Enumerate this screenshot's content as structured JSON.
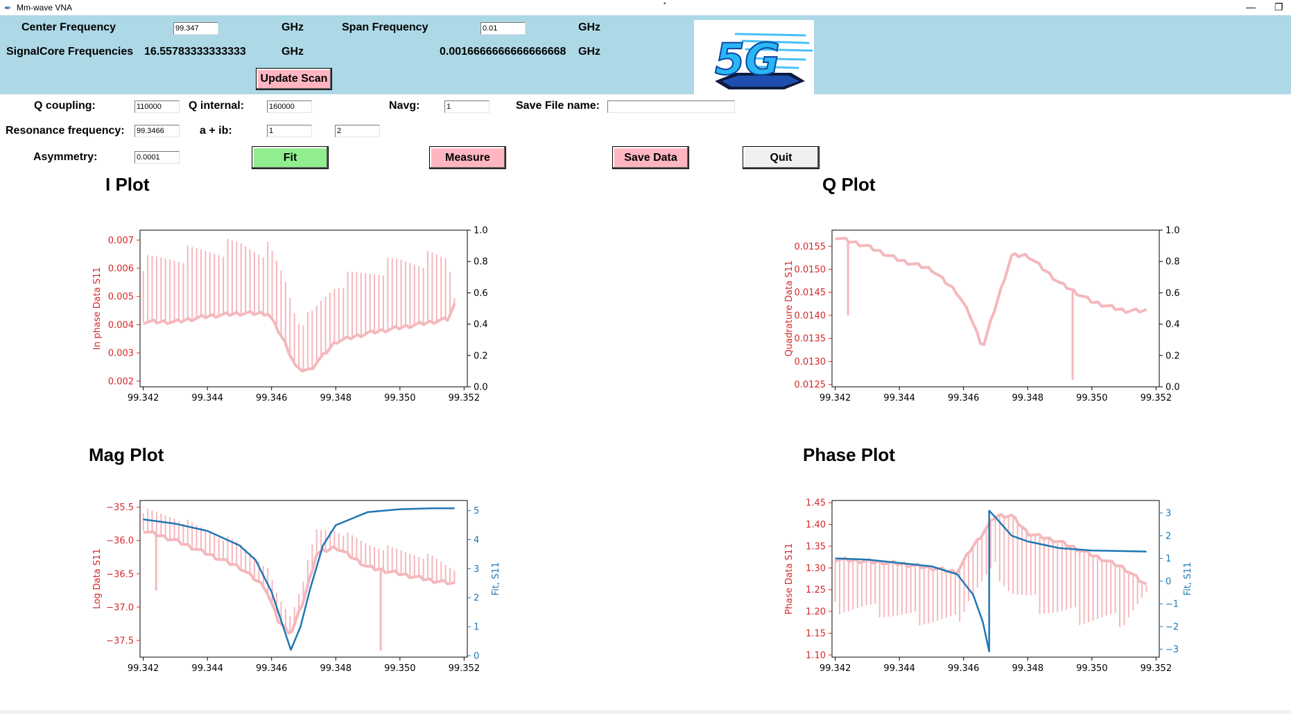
{
  "window": {
    "title": "Mm-wave VNA",
    "minimize_glyph": "—",
    "restore_glyph": "❐",
    "close_glyph": "✕"
  },
  "header": {
    "center_freq_label": "Center Frequency",
    "center_freq_value": "99.347",
    "center_unit": "GHz",
    "span_freq_label": "Span Frequency",
    "span_freq_value": "0.01",
    "span_unit": "GHz",
    "signalcore_label": "SignalCore Frequencies",
    "signalcore_center": "16.55783333333333",
    "signalcore_center_unit": "GHz",
    "signalcore_span": "0.0016666666666666668",
    "signalcore_span_unit": "GHz",
    "update_scan_label": "Update Scan",
    "logo_text": "5G"
  },
  "params": {
    "q_coupling_label": "Q coupling:",
    "q_coupling_value": "110000",
    "q_internal_label": "Q internal:",
    "q_internal_value": "160000",
    "navg_label": "Navg:",
    "navg_value": "1",
    "save_file_label": "Save File name:",
    "save_file_value": "",
    "res_freq_label": "Resonance frequency:",
    "res_freq_value": "99.3466",
    "aib_label": "a + ib:",
    "a_value": "1",
    "b_value": "2",
    "asym_label": "Asymmetry:",
    "asym_value": "0.0001"
  },
  "buttons": {
    "fit": "Fit",
    "measure": "Measure",
    "save": "Save Data",
    "quit": "Quit"
  },
  "colors": {
    "header_bg": "#add8e6",
    "data_line": "#f4b8bc",
    "fit_line": "#1f77b4",
    "left_axis": "#d62728",
    "fit_btn": "#90ee90",
    "pink_btn": "#ffb6c1",
    "quit_btn": "#f0f0f0"
  },
  "plots": {
    "i_title": "I Plot",
    "q_title": "Q Plot",
    "mag_title": "Mag Plot",
    "phase_title": "Phase Plot"
  },
  "chart_data": [
    {
      "id": "i",
      "type": "line",
      "title": "I Plot",
      "ylabel": "In phase Data S11",
      "xlim": [
        99.3419,
        99.3521
      ],
      "xticks": [
        "99.342",
        "99.344",
        "99.346",
        "99.348",
        "99.350",
        "99.352"
      ],
      "ylim": [
        0.0018,
        0.00735
      ],
      "yticks": [
        "0.002",
        "0.003",
        "0.004",
        "0.005",
        "0.006",
        "0.007"
      ],
      "right_ylim": [
        0,
        1
      ],
      "right_yticks": [
        "0.0",
        "0.2",
        "0.4",
        "0.6",
        "0.8",
        "1.0"
      ],
      "right_ylabel": "",
      "series": [
        {
          "role": "data",
          "x": [
            99.342,
            99.343,
            99.344,
            99.345,
            99.3459,
            99.3464,
            99.3468,
            99.3472,
            99.3476,
            99.348,
            99.349,
            99.35,
            99.351,
            99.3515,
            99.3517
          ],
          "y": [
            0.0041,
            0.0041,
            0.0043,
            0.0044,
            0.0044,
            0.0034,
            0.0024,
            0.0024,
            0.0029,
            0.0034,
            0.0037,
            0.0039,
            0.0041,
            0.0042,
            0.0047
          ],
          "spike_top": [
            0.0065,
            0.0068,
            0.007,
            0.0072,
            0.007,
            0.006,
            0.0045,
            0.0045,
            0.0052,
            0.0058,
            0.0062,
            0.0066,
            0.0067,
            0.0067,
            0.005
          ]
        }
      ]
    },
    {
      "id": "q",
      "type": "line",
      "title": "Q Plot",
      "ylabel": "Quadrature Data S11",
      "xlim": [
        99.3419,
        99.3521
      ],
      "xticks": [
        "99.342",
        "99.344",
        "99.346",
        "99.348",
        "99.350",
        "99.352"
      ],
      "ylim": [
        0.01245,
        0.01585
      ],
      "yticks": [
        "0.0125",
        "0.0130",
        "0.0135",
        "0.0140",
        "0.0145",
        "0.0150",
        "0.0155"
      ],
      "right_ylim": [
        0,
        1
      ],
      "right_yticks": [
        "0.0",
        "0.2",
        "0.4",
        "0.6",
        "0.8",
        "1.0"
      ],
      "right_ylabel": "",
      "series": [
        {
          "role": "data",
          "x": [
            99.342,
            99.343,
            99.344,
            99.345,
            99.3458,
            99.3462,
            99.3466,
            99.347,
            99.3475,
            99.348,
            99.349,
            99.35,
            99.351,
            99.3517
          ],
          "y": [
            0.0157,
            0.0155,
            0.0152,
            0.015,
            0.0145,
            0.014,
            0.0133,
            0.0142,
            0.0153,
            0.0153,
            0.0147,
            0.0143,
            0.0141,
            0.0141
          ],
          "spikes": [
            [
              99.3424,
              0.014
            ],
            [
              99.3494,
              0.0126
            ]
          ]
        }
      ]
    },
    {
      "id": "mag",
      "type": "line",
      "title": "Mag Plot",
      "ylabel": "Log Data S11",
      "right_ylabel": "Fit, S11",
      "xlim": [
        99.3419,
        99.3521
      ],
      "xticks": [
        "99.342",
        "99.344",
        "99.346",
        "99.348",
        "99.350",
        "99.352"
      ],
      "ylim": [
        -37.75,
        -35.4
      ],
      "yticks": [
        "−35.5",
        "−36.0",
        "−36.5",
        "−37.0",
        "−37.5"
      ],
      "right_ylim": [
        -0.05,
        5.35
      ],
      "right_yticks": [
        "0",
        "1",
        "2",
        "3",
        "4",
        "5"
      ],
      "series": [
        {
          "role": "data",
          "x": [
            99.342,
            99.343,
            99.344,
            99.345,
            99.3458,
            99.3462,
            99.3466,
            99.347,
            99.3474,
            99.348,
            99.349,
            99.35,
            99.351,
            99.3517
          ],
          "y": [
            -35.85,
            -36.0,
            -36.2,
            -36.4,
            -36.7,
            -37.2,
            -37.4,
            -36.9,
            -36.2,
            -36.1,
            -36.4,
            -36.5,
            -36.6,
            -36.65
          ],
          "spike_top": [
            -35.5,
            -35.6,
            -35.8,
            -36.0,
            -36.3,
            -36.8,
            -37.1,
            -36.5,
            -35.8,
            -35.8,
            -36.0,
            -36.1,
            -36.2,
            -36.4
          ],
          "spikes": [
            [
              99.3424,
              -36.75
            ],
            [
              99.3494,
              -37.65
            ]
          ]
        },
        {
          "role": "fit",
          "x": [
            99.342,
            99.343,
            99.344,
            99.345,
            99.3455,
            99.346,
            99.3463,
            99.3466,
            99.3469,
            99.3472,
            99.3476,
            99.348,
            99.349,
            99.35,
            99.351,
            99.3517
          ],
          "y": [
            4.7,
            4.55,
            4.3,
            3.8,
            3.3,
            2.2,
            1.2,
            0.2,
            1.0,
            2.3,
            3.8,
            4.5,
            4.95,
            5.05,
            5.08,
            5.08
          ]
        }
      ]
    },
    {
      "id": "phase",
      "type": "line",
      "title": "Phase Plot",
      "ylabel": "Phase Data S11",
      "right_ylabel": "Fit, S11",
      "xlim": [
        99.3419,
        99.3521
      ],
      "xticks": [
        "99.342",
        "99.344",
        "99.346",
        "99.348",
        "99.350",
        "99.352"
      ],
      "ylim": [
        1.095,
        1.455
      ],
      "yticks": [
        "1.10",
        "1.15",
        "1.20",
        "1.25",
        "1.30",
        "1.35",
        "1.40",
        "1.45"
      ],
      "right_ylim": [
        -3.35,
        3.55
      ],
      "right_yticks": [
        "−3",
        "−2",
        "−1",
        "0",
        "1",
        "2",
        "3"
      ],
      "series": [
        {
          "role": "data",
          "x": [
            99.342,
            99.343,
            99.344,
            99.345,
            99.3458,
            99.3462,
            99.3466,
            99.347,
            99.3475,
            99.348,
            99.349,
            99.35,
            99.351,
            99.3517
          ],
          "y": [
            1.32,
            1.315,
            1.31,
            1.3,
            1.29,
            1.34,
            1.38,
            1.42,
            1.42,
            1.38,
            1.36,
            1.33,
            1.3,
            1.26
          ],
          "spike_low": [
            1.19,
            1.19,
            1.17,
            1.16,
            1.16,
            1.22,
            1.25,
            1.28,
            1.22,
            1.2,
            1.17,
            1.16,
            1.16,
            1.24
          ]
        },
        {
          "role": "fit",
          "x": [
            99.342,
            99.343,
            99.344,
            99.345,
            99.3458,
            99.3463,
            99.3466,
            99.3468,
            99.3468,
            99.347,
            99.3475,
            99.348,
            99.349,
            99.35,
            99.351,
            99.3517
          ],
          "y": [
            1.0,
            0.95,
            0.8,
            0.65,
            0.3,
            -0.6,
            -1.8,
            -3.1,
            3.1,
            2.8,
            2.0,
            1.75,
            1.45,
            1.35,
            1.32,
            1.3
          ]
        }
      ]
    }
  ]
}
